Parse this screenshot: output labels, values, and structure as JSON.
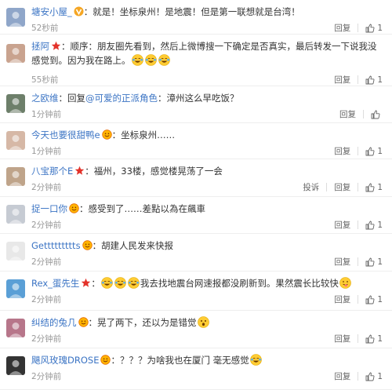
{
  "ui": {
    "reply_label": "回复",
    "report_label": "投诉",
    "colon": "："
  },
  "comments": [
    {
      "user": "塘安小屋_",
      "badge": "v-badge",
      "segments": [
        "就是！坐标泉州！是地震！但是第一联想就是台湾！"
      ],
      "time": "52秒前",
      "likes": "1",
      "report": false
    },
    {
      "user": "拯阿",
      "badge": "star-badge",
      "segments": [
        "顺序：朋友圈先看到，然后上微博搜一下确定是否真实，最后转发一下说我没感觉到。因为我在路上。"
      ],
      "emoji_after": [
        "laugh-cry-emoji",
        "laugh-cry-emoji",
        "laugh-cry-emoji"
      ],
      "time": "55秒前",
      "likes": "1",
      "report": false
    },
    {
      "user": "之欧维",
      "badge": "",
      "prefix": "回复",
      "mention": "@可爱的正派角色",
      "segments": [
        "漳州这么早吃饭？"
      ],
      "time": "1分钟前",
      "likes": "",
      "report": false
    },
    {
      "user": "今天也要很甜鸭e",
      "badge": "smile-badge",
      "segments": [
        "坐标泉州……"
      ],
      "time": "1分钟前",
      "likes": "1",
      "report": false
    },
    {
      "user": "八宝那个E",
      "badge": "star-badge",
      "segments": [
        "福州，33楼，感觉楼晃荡了一会"
      ],
      "time": "2分钟前",
      "likes": "1",
      "report": true
    },
    {
      "user": "捉一口你",
      "badge": "smile-badge",
      "segments": [
        "感受到了……差點以為在飆車"
      ],
      "time": "2分钟前",
      "likes": "1",
      "report": false
    },
    {
      "user": "Gettttttttts",
      "badge": "smile-badge",
      "segments": [
        "胡建人民发来快报"
      ],
      "time": "2分钟前",
      "likes": "1",
      "report": false
    },
    {
      "user": "Rex_蛋先生",
      "badge": "star-badge",
      "emoji_before": [
        "laugh-cry-emoji",
        "laugh-cry-emoji",
        "laugh-cry-emoji"
      ],
      "segments": [
        "我去找地震台网速报都没刷新到。果然震长比较快"
      ],
      "emoji_after": [
        "tongue-emoji"
      ],
      "time": "2分钟前",
      "likes": "1",
      "report": false
    },
    {
      "user": "纠结的兔几",
      "badge": "smile-badge",
      "segments": [
        "晃了两下，还以为是错觉"
      ],
      "emoji_after": [
        "surprised-emoji"
      ],
      "time": "2分钟前",
      "likes": "1",
      "report": false
    },
    {
      "user": "飓风玫瑰DROSE",
      "badge": "smile-badge",
      "segments": [
        "？？？为啥我也在厦门 毫无感觉"
      ],
      "emoji_after": [
        "laugh-cry-emoji"
      ],
      "time": "2分钟前",
      "likes": "1",
      "report": false
    }
  ],
  "colors": {
    "link": "#3b74c4",
    "text": "#333333",
    "meta": "#999999",
    "star": "#e3322a",
    "v": "#f5a623"
  }
}
